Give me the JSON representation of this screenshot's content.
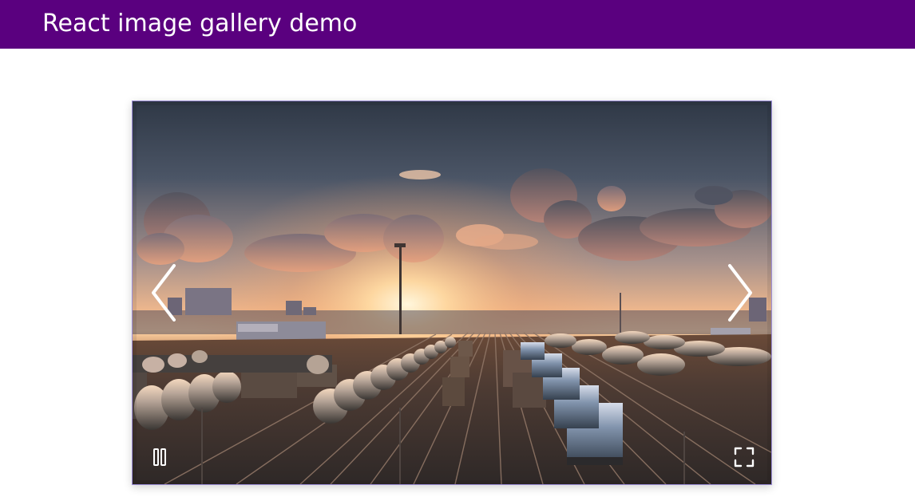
{
  "header": {
    "title": "React image gallery demo",
    "background": "#5a007f"
  },
  "gallery": {
    "image_alt": "Railway yard at sunset with freight trains and tank cars",
    "border_color": "#9d8fd9",
    "icons": {
      "left_nav": "chevron-left-icon",
      "right_nav": "chevron-right-icon",
      "play_pause": "pause-icon",
      "fullscreen": "fullscreen-icon"
    }
  }
}
